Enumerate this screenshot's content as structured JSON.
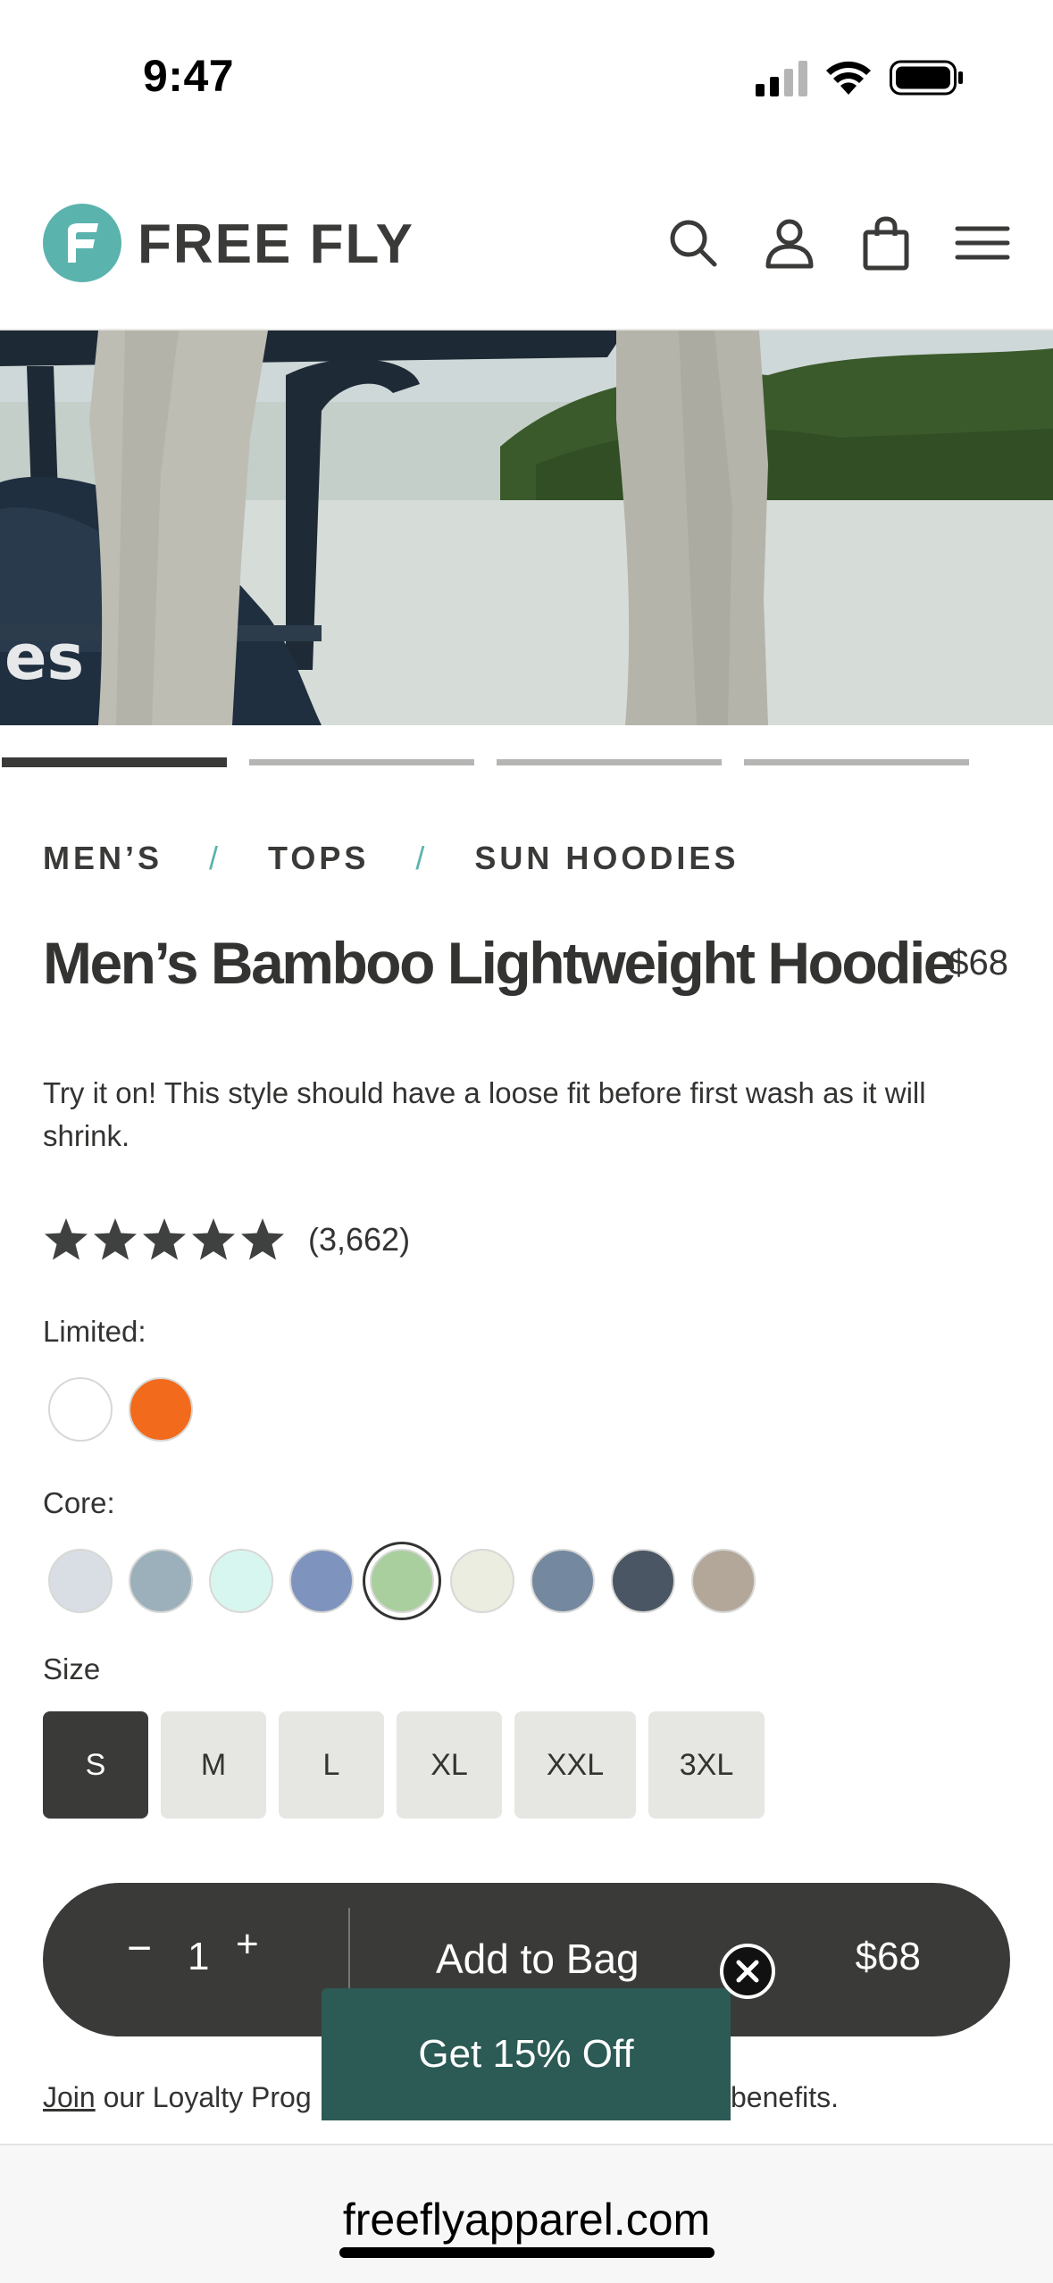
{
  "status_bar": {
    "time": "9:47"
  },
  "header": {
    "brand": "FREE FLY",
    "icons": [
      "search-icon",
      "account-icon",
      "shopping-bag-icon",
      "menu-icon"
    ]
  },
  "carousel": {
    "slide_count": 4,
    "active_index": 0
  },
  "breadcrumb": [
    "MEN’S",
    "TOPS",
    "SUN HOODIES"
  ],
  "breadcrumb_separator": "/",
  "product": {
    "title": "Men’s Bamboo Lightweight Hoodie",
    "price": "$68",
    "fit_note": "Try it on! This style should have a loose fit before first wash as it will shrink.",
    "rating": 5,
    "review_count": "(3,662)"
  },
  "colors": {
    "limited_label": "Limited:",
    "limited": [
      "#ffffff",
      "#f26a1b"
    ],
    "core_label": "Core:",
    "core": [
      "#d8dee4",
      "#9cb0bb",
      "#d8f6f0",
      "#7e93bd",
      "#a9cf9e",
      "#eaeddf",
      "#74889f",
      "#4a5663",
      "#b3a79a"
    ],
    "core_selected_index": 4
  },
  "size": {
    "label": "Size",
    "options": [
      "S",
      "M",
      "L",
      "XL",
      "XXL",
      "3XL"
    ],
    "selected_index": 0
  },
  "add_to_bag": {
    "minus": "−",
    "quantity": "1",
    "plus": "+",
    "label": "Add to Bag",
    "price": "$68"
  },
  "promo": {
    "label": "Get 15% Off"
  },
  "loyalty": {
    "join": "Join",
    "text_start": " our Loyalty Prog",
    "text_end": "benefits."
  },
  "browser": {
    "url": "freeflyapparel.com"
  }
}
